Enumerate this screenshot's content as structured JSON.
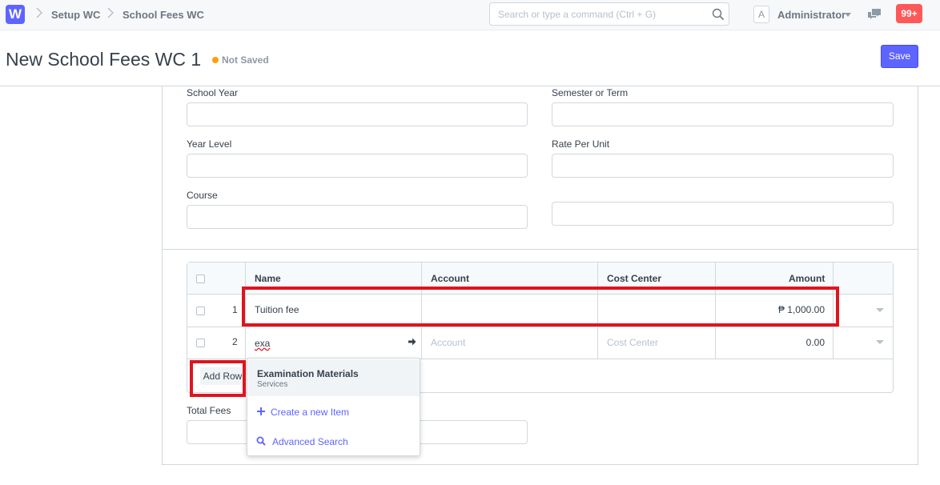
{
  "navbar": {
    "logo_letter": "W",
    "breadcrumbs": [
      "Setup WC",
      "School Fees WC"
    ],
    "search_placeholder": "Search or type a command (Ctrl + G)",
    "avatar_letter": "A",
    "user_name": "Administrator",
    "notification_count": "99+"
  },
  "page": {
    "title": "New School Fees WC 1",
    "status": "Not Saved",
    "save_label": "Save"
  },
  "form": {
    "school_year_label": "School Year",
    "semester_label": "Semester or Term",
    "year_level_label": "Year Level",
    "rate_per_unit_label": "Rate Per Unit",
    "course_label": "Course",
    "total_fees_label": "Total Fees"
  },
  "grid": {
    "columns": [
      "Name",
      "Account",
      "Cost Center",
      "Amount"
    ],
    "rows": [
      {
        "idx": "1",
        "name": "Tuition fee",
        "account": "",
        "cost_center": "",
        "amount": "₱ 1,000.00"
      },
      {
        "idx": "2",
        "name": "exa",
        "account_placeholder": "Account",
        "cost_center_placeholder": "Cost Center",
        "amount": "0.00"
      }
    ],
    "add_row_label": "Add Row"
  },
  "dropdown": {
    "item_title": "Examination Materials",
    "item_subtitle": "Services",
    "create_label": "Create a new Item",
    "advanced_label": "Advanced Search"
  },
  "colors": {
    "primary": "#5e64ff",
    "warning": "#ffa00a",
    "highlight": "#e0141e",
    "badge": "#ff5858"
  }
}
